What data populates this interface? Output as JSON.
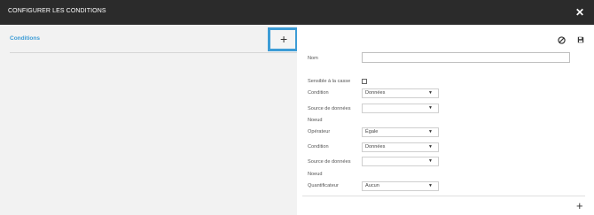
{
  "window": {
    "title": "CONFIGURER LES CONDITIONS",
    "close_symbol": "✕"
  },
  "left": {
    "heading": "Conditions",
    "add_symbol": "+"
  },
  "toolbar": {
    "cancel_icon": "cancel-icon",
    "save_icon": "save-icon"
  },
  "form": {
    "name_label": "Nom",
    "name_value": "",
    "case_sensitive_label": "Sensible à la casse",
    "condition_label_1": "Condition",
    "condition_value_1": "Données",
    "source_label_1": "Source de données",
    "source_value_1": "",
    "node_label_1": "Noeud",
    "operator_label": "Opérateur",
    "operator_value": "Égale",
    "condition_label_2": "Condition",
    "condition_value_2": "Données",
    "source_label_2": "Source de données",
    "source_value_2": "",
    "node_label_2": "Noeud",
    "quantifier_label": "Quantificateur",
    "quantifier_value": "Aucun",
    "add_row_symbol": "+"
  },
  "colors": {
    "titlebar": "#2b2b2b",
    "accent": "#3d9cd6",
    "left_panel": "#f2f2f2"
  }
}
